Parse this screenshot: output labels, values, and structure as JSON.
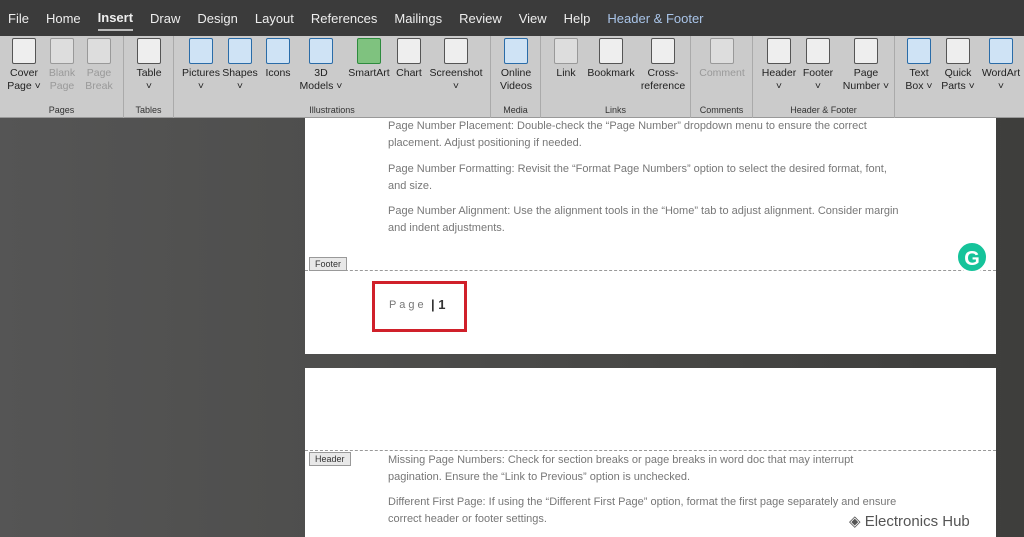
{
  "tabs": [
    "File",
    "Home",
    "Insert",
    "Draw",
    "Design",
    "Layout",
    "References",
    "Mailings",
    "Review",
    "View",
    "Help",
    "Header & Footer"
  ],
  "ribbon": {
    "pages": {
      "label": "Pages",
      "cover": "Cover",
      "cover2": "Page ˅",
      "blank": "Blank",
      "blank2": "Page",
      "break": "Page",
      "break2": "Break"
    },
    "tables": {
      "label": "Tables",
      "table": "Table",
      "table2": "˅"
    },
    "illustrations": {
      "label": "Illustrations",
      "pictures": "Pictures",
      "shapes": "Shapes",
      "icons": "Icons",
      "models": "3D",
      "models2": "Models ˅",
      "smartart": "SmartArt",
      "chart": "Chart",
      "screenshot": "Screenshot",
      "caret": "˅"
    },
    "media": {
      "label": "Media",
      "online": "Online",
      "online2": "Videos"
    },
    "links": {
      "label": "Links",
      "link": "Link",
      "bookmark": "Bookmark",
      "cross": "Cross-",
      "cross2": "reference"
    },
    "comments": {
      "label": "Comments",
      "comment": "Comment"
    },
    "hf": {
      "label": "Header & Footer",
      "header": "Header",
      "footer": "Footer",
      "pagenum": "Page",
      "pagenum2": "Number ˅",
      "caret": "˅"
    },
    "text": {
      "textbox": "Text",
      "textbox2": "Box ˅",
      "quick": "Quick",
      "quick2": "Parts ˅",
      "wordart": "WordArt",
      "caret": "˅"
    }
  },
  "page1": {
    "paras": [
      "Page Number Placement: Double-check the “Page Number” dropdown menu to ensure the correct placement. Adjust positioning if needed.",
      "Page Number Formatting: Revisit the “Format Page Numbers” option to select the desired format, font, and size.",
      "Page Number Alignment: Use the alignment tools in the “Home” tab to adjust alignment. Consider margin and indent adjustments."
    ],
    "footer_tag": "Footer",
    "page_label": "P a g e",
    "page_number": "| 1"
  },
  "page2": {
    "header_tag": "Header",
    "paras": [
      "Missing Page Numbers: Check for section breaks or page breaks in word doc that may interrupt pagination. Ensure the “Link to Previous” option is unchecked.",
      "Different First Page: If using the “Different First Page” option, format the first page separately and ensure correct header or footer settings."
    ]
  },
  "grammarly": "G",
  "watermark": "Electronics Hub",
  "colors": {
    "highlight": "#d0202a",
    "grammarly": "#15c39a"
  }
}
